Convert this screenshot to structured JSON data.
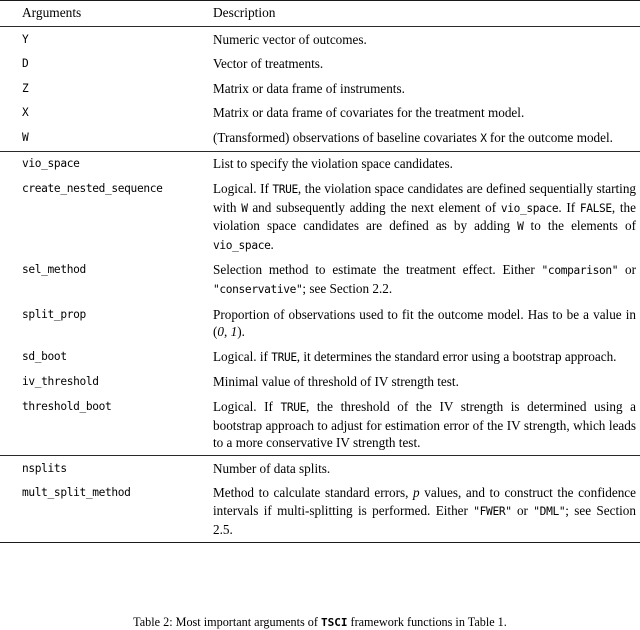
{
  "table": {
    "headers": {
      "arguments": "Arguments",
      "description": "Description"
    },
    "groups": [
      {
        "rows": [
          {
            "arg": "Y",
            "desc_html": "Numeric vector of outcomes."
          },
          {
            "arg": "D",
            "desc_html": "Vector of treatments."
          },
          {
            "arg": "Z",
            "desc_html": "Matrix or data frame of instruments."
          },
          {
            "arg": "X",
            "desc_html": "Matrix or data frame of covariates for the treatment model."
          },
          {
            "arg": "W",
            "desc_html": "(Transformed) observations of baseline covariates <code>X</code> for the outcome model."
          }
        ]
      },
      {
        "rows": [
          {
            "arg": "vio_space",
            "desc_html": "List to specify the violation space candidates."
          },
          {
            "arg": "create_nested_sequence",
            "desc_html": "Logical. If <code>TRUE</code>, the violation space candidates are defined sequentially starting with <code>W</code> and subsequently adding the next element of <code>vio_space</code>. If <code>FALSE</code>, the violation space candi&shy;dates are defined as by adding <code>W</code> to the elements of <code>vio_space</code>."
          },
          {
            "arg": "sel_method",
            "desc_html": "Selection method to estimate the treatment effect. Either <code>\"comparison\"</code> or <code>\"conservative\"</code>; see Section 2.2."
          },
          {
            "arg": "split_prop",
            "desc_html": "Proportion of observations used to fit the outcome model. Has to be a value in <span class=\"math\">(<span class=\"mi\">0</span>, <span class=\"mi\">1</span>)</span>."
          },
          {
            "arg": "sd_boot",
            "desc_html": "Logical. if <code>TRUE</code>, it determines the standard error using a bootstrap approach."
          },
          {
            "arg": "iv_threshold",
            "desc_html": "Minimal value of threshold of IV strength test."
          },
          {
            "arg": "threshold_boot",
            "desc_html": "Logical. If <code>TRUE</code>, the threshold of the IV strength is deter&shy;mined using a bootstrap approach to adjust for estimation error of the IV strength, which leads to a more conservative IV strength test."
          }
        ]
      },
      {
        "rows": [
          {
            "arg": "nsplits",
            "desc_html": "Number of data splits."
          },
          {
            "arg": "mult_split_method",
            "desc_html": "Method to calculate standard errors, <span class=\"mi\">p</span> values, and to con&shy;struct the confidence intervals if multi-splitting is performed. Either <code>\"FWER\"</code> or <code>\"DML\"</code>; see Section 2.5."
          }
        ]
      }
    ]
  },
  "caption": {
    "prefix": "Table 2:",
    "text_before_code": " Most important arguments of ",
    "code": "TSCI",
    "text_after_code": " framework functions in Table 1."
  }
}
